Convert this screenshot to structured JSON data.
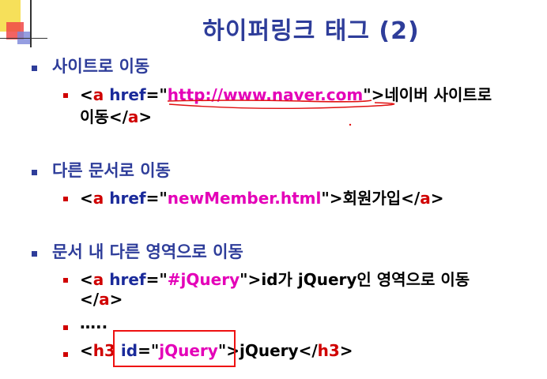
{
  "title": "하이퍼링크 태그 (2)",
  "colors": {
    "heading": "#2e3d9a",
    "tag": "#d00000",
    "value": "#e400b8",
    "highlight": "#ee1111"
  },
  "sections": [
    {
      "heading": "사이트로 이동",
      "lines": [
        {
          "lt": "<",
          "tag_open": "a",
          "attr": "href",
          "eq": "=\"",
          "value": "http://www.naver.com",
          "close_q": "\">",
          "text": "네이버 사이트로"
        },
        {
          "text": "이동",
          "close_lt": "</",
          "tag_close": "a",
          "gt": ">"
        }
      ]
    },
    {
      "heading": "다른 문서로 이동",
      "lines": [
        {
          "lt": "<",
          "tag_open": "a",
          "attr": "href",
          "eq": "=\"",
          "value": "newMember.html",
          "close_q": "\">",
          "text": "회원가입",
          "close_lt": "</",
          "tag_close": "a",
          "gt": ">"
        }
      ]
    },
    {
      "heading": "문서 내 다른 영역으로 이동",
      "lines": [
        {
          "lt": "<",
          "tag_open": "a",
          "attr": "href",
          "eq": "=\"",
          "value": "#jQuery",
          "close_q": "\">",
          "text": "id가 jQuery인 영역으로 이동"
        },
        {
          "close_lt": "</",
          "tag_close": "a",
          "gt": ">"
        },
        {
          "text": "….."
        },
        {
          "lt": "<",
          "tag_open": "h3",
          "attr": "id",
          "eq": "=\"",
          "value": "jQuery",
          "close_q": "\">",
          "text": "jQuery",
          "close_lt": "</",
          "tag_close": "h3",
          "gt": ">"
        }
      ]
    }
  ]
}
